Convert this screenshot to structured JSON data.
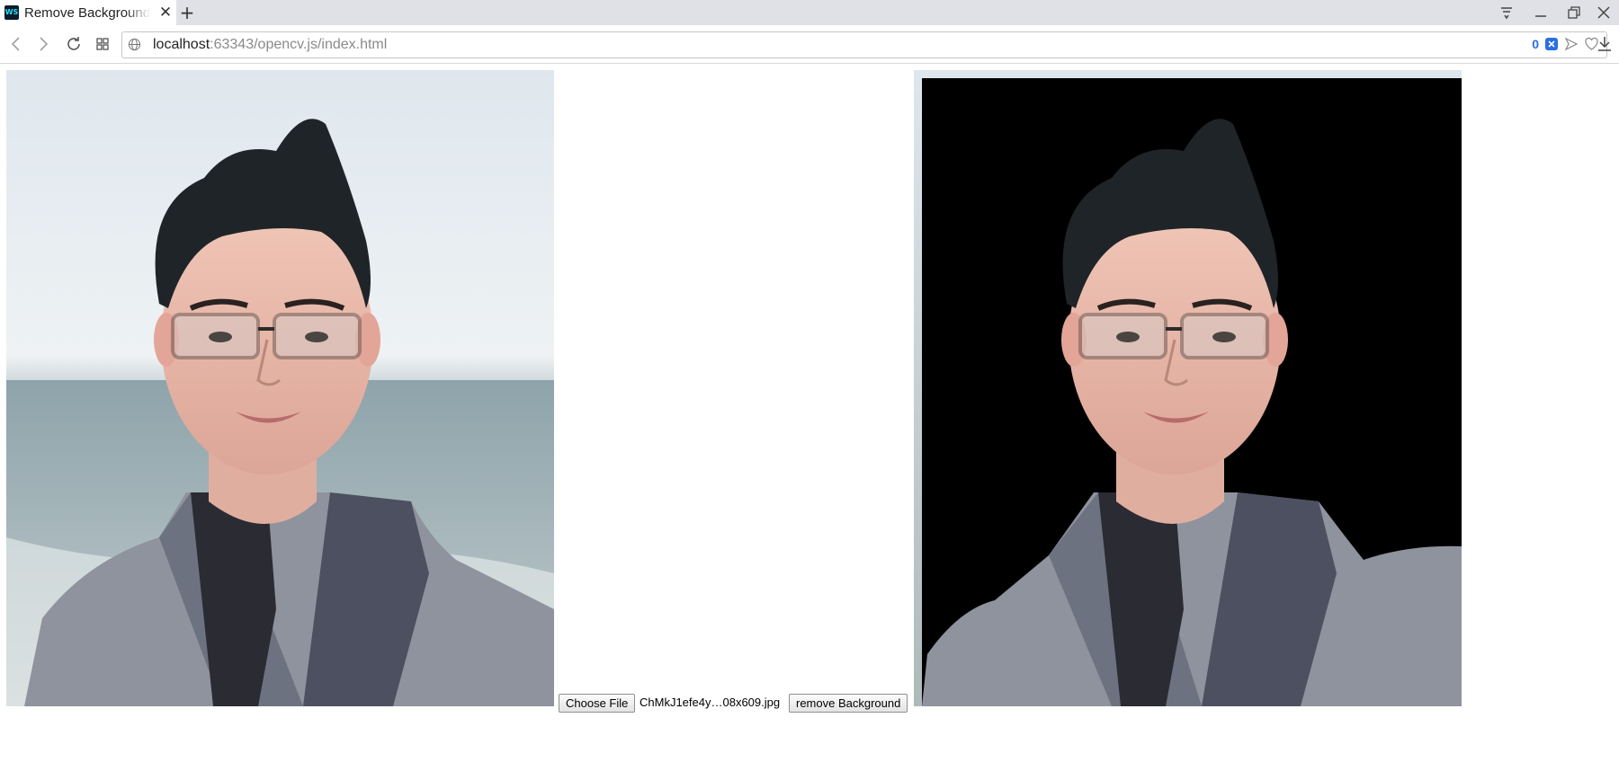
{
  "browser": {
    "tab": {
      "title": "Remove Background",
      "favicon": "WS"
    },
    "address": {
      "host": "localhost",
      "rest": ":63343/opencv.js/index.html",
      "badge_count": "0"
    }
  },
  "page": {
    "file_input": {
      "button_label": "Choose File",
      "file_name": "ChMkJ1efe4y…08x609.jpg"
    },
    "remove_button_label": "remove Background",
    "images": [
      {
        "role": "original",
        "background": "beach-sky"
      },
      {
        "role": "result",
        "background": "black"
      }
    ]
  },
  "colors": {
    "accent": "#2a6ee6",
    "tab_strip": "#dfe1e6",
    "result_background": "#000000"
  }
}
